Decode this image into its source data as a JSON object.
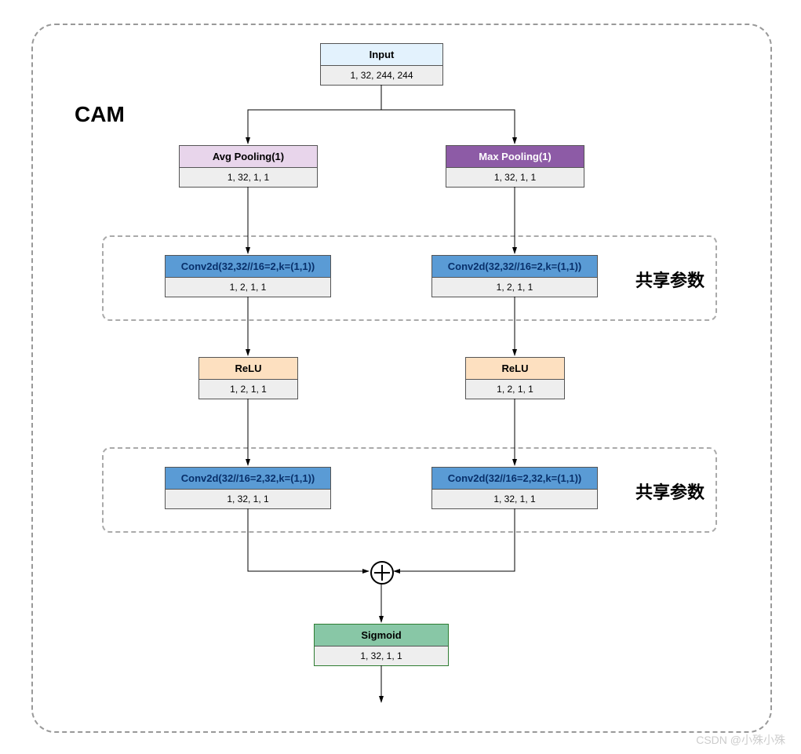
{
  "title": "CAM",
  "watermark": "CSDN @小殊小殊",
  "shared_label": "共享参数",
  "nodes": {
    "input": {
      "label": "Input",
      "shape": "1, 32, 244, 244"
    },
    "avgpool": {
      "label": "Avg Pooling(1)",
      "shape": "1, 32, 1, 1"
    },
    "maxpool": {
      "label": "Max Pooling(1)",
      "shape": "1, 32, 1, 1"
    },
    "conv1_l": {
      "label": "Conv2d(32,32//16=2,k=(1,1))",
      "shape": "1, 2, 1, 1"
    },
    "conv1_r": {
      "label": "Conv2d(32,32//16=2,k=(1,1))",
      "shape": "1, 2, 1, 1"
    },
    "relu_l": {
      "label": "ReLU",
      "shape": "1, 2, 1, 1"
    },
    "relu_r": {
      "label": "ReLU",
      "shape": "1, 2, 1, 1"
    },
    "conv2_l": {
      "label": "Conv2d(32//16=2,32,k=(1,1))",
      "shape": "1, 32, 1, 1"
    },
    "conv2_r": {
      "label": "Conv2d(32//16=2,32,k=(1,1))",
      "shape": "1, 32, 1, 1"
    },
    "sigmoid": {
      "label": "Sigmoid",
      "shape": "1, 32, 1, 1"
    }
  }
}
